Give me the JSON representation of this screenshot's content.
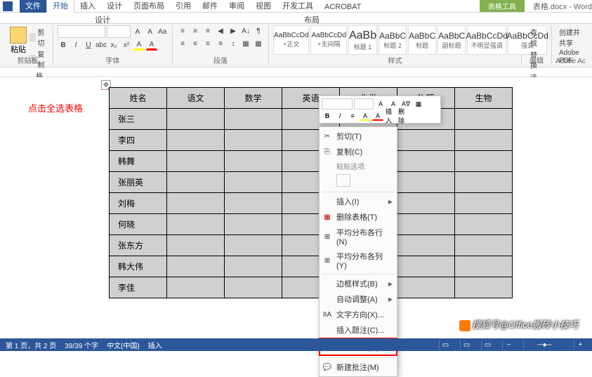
{
  "title": {
    "context_label": "表格工具",
    "doc": "表格.docx - Word"
  },
  "tabs": {
    "file": "文件",
    "home": "开始",
    "insert": "插入",
    "design": "设计",
    "layout": "页面布局",
    "ref": "引用",
    "mail": "邮件",
    "review": "审阅",
    "view": "视图",
    "dev": "开发工具",
    "acrobat": "ACROBAT",
    "tdesign": "设计",
    "tlayout": "布局"
  },
  "ribbon": {
    "clipboard": {
      "paste": "粘贴",
      "cut": "剪切",
      "copy": "复制",
      "fmt": "格式刷",
      "label": "剪贴板"
    },
    "font_label": "字体",
    "para_label": "段落",
    "styles": [
      {
        "prev": "AaBbCcDd",
        "name": "+正文"
      },
      {
        "prev": "AaBbCcDd",
        "name": "+无间隔"
      },
      {
        "prev": "AaBb",
        "name": "标题 1"
      },
      {
        "prev": "AaBbC",
        "name": "标题 2"
      },
      {
        "prev": "AaBbC",
        "name": "标题"
      },
      {
        "prev": "AaBbC",
        "name": "副标题"
      },
      {
        "prev": "AaBbCcDd",
        "name": "不明显强调"
      },
      {
        "prev": "AaBbCcDd",
        "name": "强调"
      }
    ],
    "styles_label": "样式",
    "edit": {
      "find": "查找",
      "replace": "替换",
      "select": "选择",
      "label": "编辑"
    },
    "adobe": {
      "share": "创建并共享",
      "pdf": "Adobe PDF",
      "label": "Adobe Ac"
    }
  },
  "annotation": "点击全选表格",
  "table": {
    "headers": [
      "姓名",
      "语文",
      "数学",
      "英语",
      "化学",
      "物理",
      "生物"
    ],
    "rows": [
      "张三",
      "李四",
      "韩舞",
      "张丽英",
      "刘梅",
      "何晓",
      "张东方",
      "韩大伟",
      "李佳"
    ]
  },
  "minitoolbar": {
    "insert": "插入",
    "delete": "删除"
  },
  "context_menu": {
    "cut": "剪切(T)",
    "copy": "复制(C)",
    "paste_opts": "粘贴选项:",
    "insert": "插入(I)",
    "del_table": "删除表格(T)",
    "dist_rows": "平均分布各行(N)",
    "dist_cols": "平均分布各列(Y)",
    "border_style": "边框样式(B)",
    "autofit": "自动调整(A)",
    "text_dir": "文字方向(X)...",
    "ins_caption": "插入题注(C)...",
    "tbl_props": "表格属性(R)...",
    "new_comment": "新建批注(M)"
  },
  "watermark": "搜狐号@Office搬砖小技巧",
  "status": {
    "page": "第 1 页，共 2 页",
    "words": "39/39 个字",
    "lang": "中文(中国)",
    "mode": "插入"
  }
}
